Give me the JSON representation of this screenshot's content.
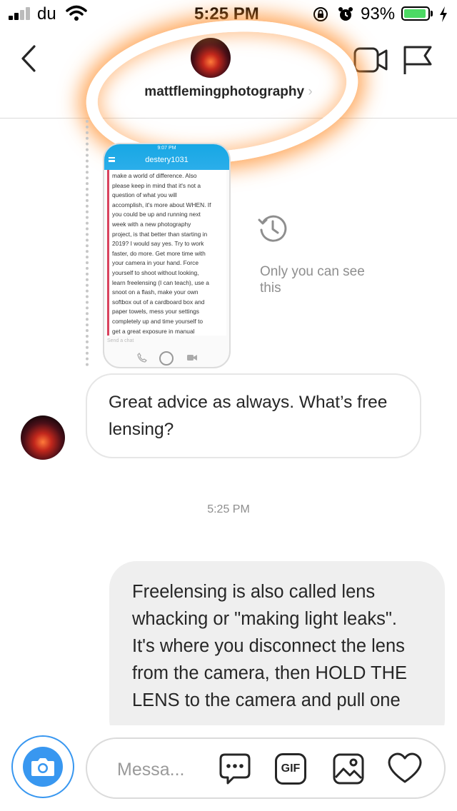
{
  "status_bar": {
    "carrier": "du",
    "time": "5:25 PM",
    "battery_percent": "93%",
    "battery_level": 0.93
  },
  "header": {
    "username": "mattflemingphotography",
    "icons": [
      "back-chevron-icon",
      "profile-avatar",
      "video-call-icon",
      "report-flag-icon"
    ]
  },
  "story_reply": {
    "screen_status": "9:07 PM",
    "screen_title": "destery1031",
    "screen_text": "make a world of difference. Also\nplease keep in mind that it's not a\nquestion of what you will\naccomplish, it's more about WHEN. If\nyou could be up and running next\nweek with a new photography\nproject, is that better than starting in\n2019? I would say yes. Try to work\nfaster, do more. Get more time with\nyour camera in your hand. Force\nyourself to shoot without looking,\nlearn freelensing (I can teach), use a\nsnoot on a flash, make your own\nsoftbox out of a cardboard box and\npaper towels, mess your settings\ncompletely up and time yourself to\nget a great exposure in manual",
    "screen_send_placeholder": "Send a chat",
    "visibility_note": "Only you can see this"
  },
  "messages": [
    {
      "direction": "incoming",
      "text": "Great advice as always. What’s free lensing?"
    },
    {
      "direction": "outgoing",
      "text": "Freelensing is also called lens whacking or \"making light leaks\". It's where you disconnect the lens from the camera, then HOLD THE LENS to the camera and pull one"
    }
  ],
  "timestamp": "5:25 PM",
  "composer": {
    "placeholder": "Message...",
    "visible_placeholder": "Messa...",
    "gif_label": "GIF",
    "accent_color": "#3897f0"
  },
  "colors": {
    "battery_green": "#4cd964",
    "highlight_orange": "#ff8c28",
    "story_blue": "#17a7e4"
  }
}
